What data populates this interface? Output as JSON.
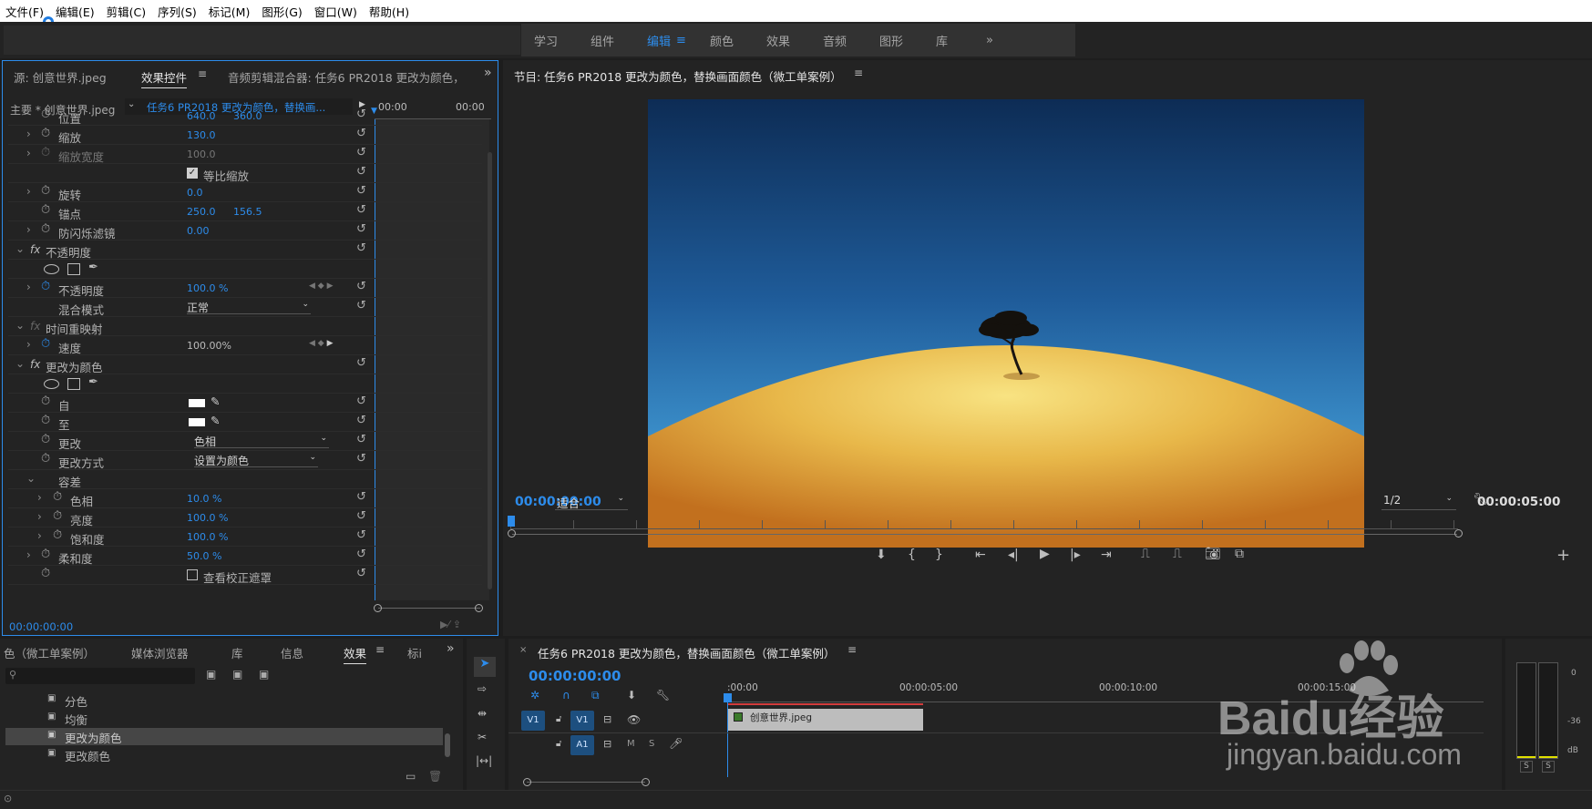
{
  "menu": [
    "文件(F)",
    "编辑(E)",
    "剪辑(C)",
    "序列(S)",
    "标记(M)",
    "图形(G)",
    "窗口(W)",
    "帮助(H)"
  ],
  "workspaces": [
    "学习",
    "组件",
    "编辑",
    "颜色",
    "效果",
    "音频",
    "图形",
    "库"
  ],
  "source_panel": {
    "tab_source": "源: 创意世界.jpeg",
    "tab_effect": "效果控件",
    "tab_mixer": "音频剪辑混合器: 任务6 PR2018 更改为颜色，",
    "master_label": "主要 * 创意世界.jpeg",
    "clip_label": "任务6 PR2018 更改为颜色，替换画...",
    "time_start": "00:00",
    "time_end": "00:00",
    "footer_time": "00:00:00:00"
  },
  "effects": {
    "position": {
      "label": "位置",
      "x": "640.0",
      "y": "360.0"
    },
    "scale": {
      "label": "缩放",
      "value": "130.0"
    },
    "scale_width": {
      "label": "缩放宽度",
      "value": "100.0"
    },
    "uniform": {
      "label": "等比缩放"
    },
    "rotation": {
      "label": "旋转",
      "value": "0.0"
    },
    "anchor": {
      "label": "锚点",
      "x": "250.0",
      "y": "156.5"
    },
    "flicker": {
      "label": "防闪烁滤镜",
      "value": "0.00"
    },
    "opacity_group": {
      "label": "不透明度"
    },
    "opacity": {
      "label": "不透明度",
      "value": "100.0 %"
    },
    "blend": {
      "label": "混合模式",
      "value": "正常"
    },
    "time_remap": {
      "label": "时间重映射"
    },
    "speed": {
      "label": "速度",
      "value": "100.00%"
    },
    "change_color": {
      "label": "更改为颜色"
    },
    "from": {
      "label": "自"
    },
    "to": {
      "label": "至"
    },
    "change": {
      "label": "更改",
      "value": "色相"
    },
    "change_by": {
      "label": "更改方式",
      "value": "设置为颜色"
    },
    "tolerance": {
      "label": "容差"
    },
    "hue": {
      "label": "色相",
      "value": "10.0 %"
    },
    "lightness": {
      "label": "亮度",
      "value": "100.0 %"
    },
    "saturation": {
      "label": "饱和度",
      "value": "100.0 %"
    },
    "softness": {
      "label": "柔和度",
      "value": "50.0 %"
    },
    "view_mask": {
      "label": "查看校正遮罩"
    },
    "fx": "fx"
  },
  "program": {
    "title": "节目: 任务6 PR2018 更改为颜色，替换画面颜色（微工单案例）",
    "timecode": "00:00:00:00",
    "fit": "适合",
    "resolution": "1/2",
    "duration": "00:00:05:00"
  },
  "project_panel": {
    "tabs": [
      "色（微工单案例）",
      "媒体浏览器",
      "库",
      "信息",
      "效果",
      "标i"
    ],
    "items": [
      "分色",
      "均衡",
      "更改为颜色",
      "更改颜色"
    ]
  },
  "timeline": {
    "title": "任务6 PR2018 更改为颜色，替换画面颜色（微工单案例）",
    "timecode": "00:00:00:00",
    "ruler": [
      ":00:00",
      "00:00:05:00",
      "00:00:10:00",
      "00:00:15:00"
    ],
    "tracks": {
      "v1": "V1",
      "a1": "A1",
      "m": "M",
      "s": "S"
    },
    "clip": "创意世界.jpeg"
  },
  "meter": {
    "labels": [
      "0",
      "-36",
      "dB"
    ],
    "buttons": [
      "S",
      "S"
    ]
  },
  "watermark": {
    "brand": "Baidu经验",
    "url": "jingyan.baidu.com"
  }
}
